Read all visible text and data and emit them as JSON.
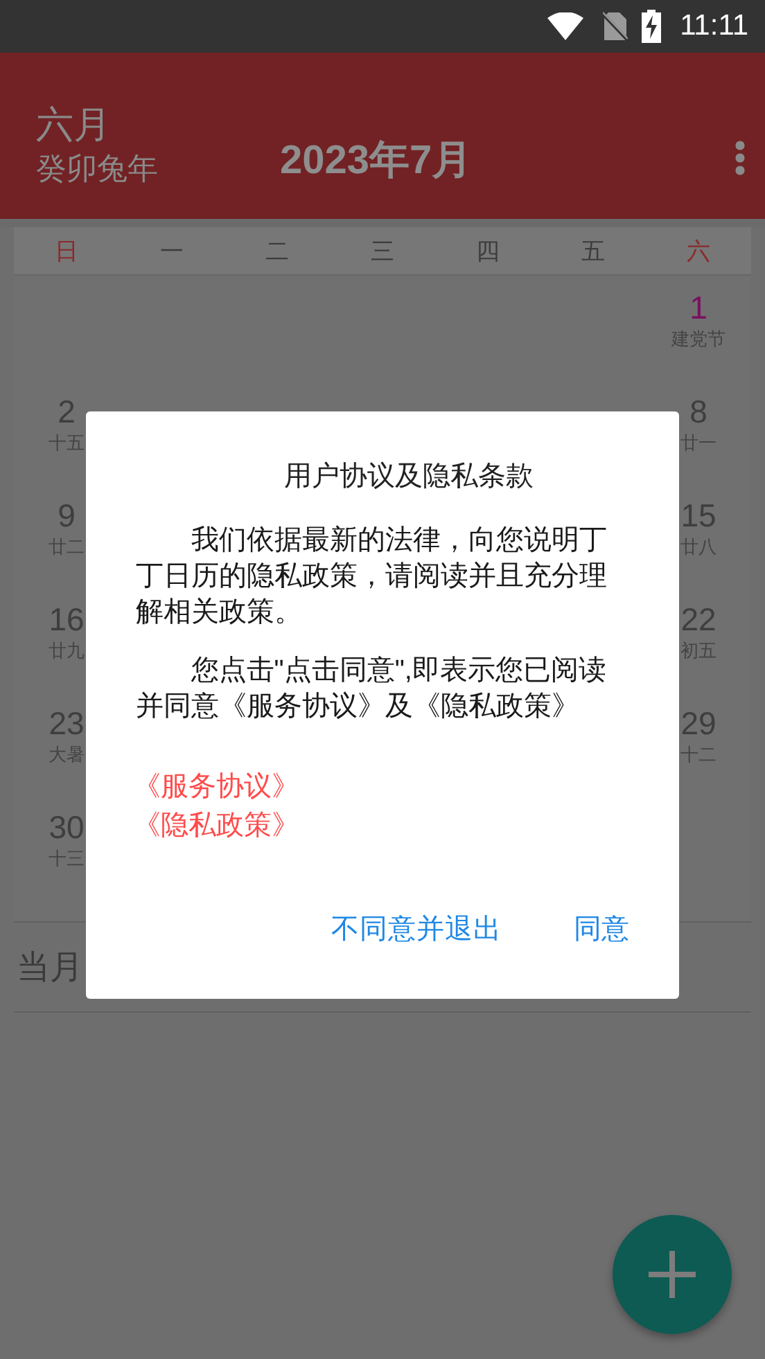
{
  "status_bar": {
    "time": "11:11"
  },
  "header": {
    "lunar_month": "六月",
    "lunar_year": "癸卯兔年",
    "title": "2023年7月"
  },
  "weekdays": [
    {
      "label": "日",
      "weekend": true
    },
    {
      "label": "一",
      "weekend": false
    },
    {
      "label": "二",
      "weekend": false
    },
    {
      "label": "三",
      "weekend": false
    },
    {
      "label": "四",
      "weekend": false
    },
    {
      "label": "五",
      "weekend": false
    },
    {
      "label": "六",
      "weekend": true
    }
  ],
  "weeks": [
    {
      "cells": [
        {},
        {},
        {},
        {},
        {},
        {},
        {
          "day": "1",
          "lunar": "建党节",
          "holiday": true
        }
      ]
    },
    {
      "cells": [
        {
          "day": "2",
          "lunar": "十五",
          "holiday": false
        },
        {},
        {},
        {},
        {},
        {},
        {
          "day": "8",
          "lunar": "廿一",
          "holiday": false
        }
      ]
    },
    {
      "cells": [
        {
          "day": "9",
          "lunar": "廿二",
          "holiday": false
        },
        {},
        {},
        {},
        {},
        {},
        {
          "day": "15",
          "lunar": "廿八",
          "holiday": false
        }
      ]
    },
    {
      "cells": [
        {
          "day": "16",
          "lunar": "廿九",
          "holiday": false
        },
        {},
        {},
        {},
        {},
        {},
        {
          "day": "22",
          "lunar": "初五",
          "holiday": false
        }
      ]
    },
    {
      "cells": [
        {
          "day": "23",
          "lunar": "大暑",
          "holiday": false
        },
        {},
        {},
        {},
        {},
        {},
        {
          "day": "29",
          "lunar": "十二",
          "holiday": false
        }
      ]
    },
    {
      "cells": [
        {
          "day": "30",
          "lunar": "十三",
          "holiday": false
        },
        {},
        {},
        {},
        {},
        {},
        {}
      ]
    }
  ],
  "month_section": {
    "label": "当月"
  },
  "dialog": {
    "title": "用户协议及隐私条款",
    "paragraphs": [
      "我们依据最新的法律，向您说明丁丁日历的隐私政策，请阅读并且充分理解相关政策。",
      "您点击\"点击同意\",即表示您已阅读并同意《服务协议》及《隐私政策》"
    ],
    "links": [
      "《服务协议》",
      "《隐私政策》"
    ],
    "buttons": [
      {
        "label": "不同意并退出",
        "kind": "decline"
      },
      {
        "label": "同意",
        "kind": "accept"
      }
    ]
  }
}
